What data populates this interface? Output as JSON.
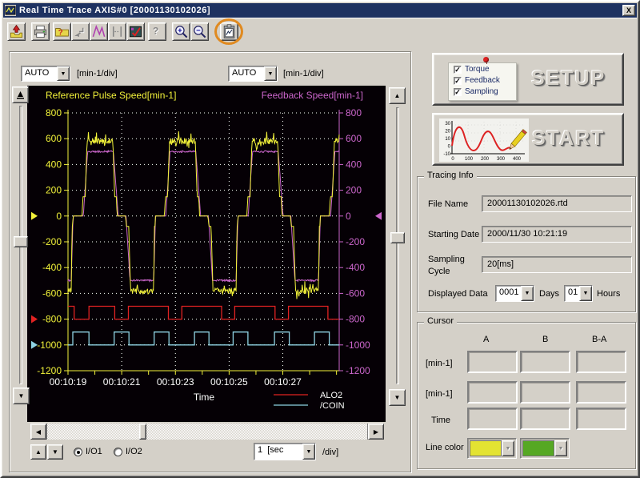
{
  "window": {
    "title": "Real Time Trace  AXIS#0 [20001130102026]",
    "close_label": "X"
  },
  "toolbar": {
    "buttons": [
      {
        "name": "load-trace-data",
        "enabled": true
      },
      {
        "name": "print",
        "enabled": true
      },
      {
        "name": "file-info",
        "enabled": true
      },
      {
        "name": "import-graph",
        "enabled": false
      },
      {
        "name": "waveform-view",
        "enabled": true
      },
      {
        "name": "span-select",
        "enabled": false
      },
      {
        "name": "trace-verify",
        "enabled": true
      },
      {
        "name": "context-help",
        "enabled": false
      },
      {
        "name": "zoom-in",
        "enabled": true
      },
      {
        "name": "zoom-out",
        "enabled": true
      },
      {
        "name": "copy-to-clipboard",
        "enabled": true,
        "highlighted": true
      }
    ]
  },
  "left_panel": {
    "left_axis_combo": {
      "value": "AUTO"
    },
    "left_axis_unit": "[min-1/div]",
    "right_axis_combo": {
      "value": "AUTO"
    },
    "right_axis_unit": "[min-1/div]",
    "io_radio": {
      "options": [
        "I/O1",
        "I/O2"
      ],
      "selected": "I/O1"
    },
    "timebase_combo": {
      "value": "1  [sec"
    },
    "timebase_unit": "/div]"
  },
  "chart_data": {
    "type": "line",
    "background": "#050005",
    "x_axis": {
      "label": "Time",
      "total_seconds": 10.1,
      "tick_step_seconds": 1,
      "labeled_ticks": [
        {
          "t": 0,
          "label": "00:10:19"
        },
        {
          "t": 2,
          "label": "00:10:21"
        },
        {
          "t": 4,
          "label": "00:10:23"
        },
        {
          "t": 6,
          "label": "00:10:25"
        },
        {
          "t": 8,
          "label": "00:10:27"
        }
      ],
      "grid_seconds": [
        2,
        4,
        6,
        8
      ],
      "color": "#f2f23a",
      "label_color": "#ffffff"
    },
    "y_axis_left": {
      "title": "Reference Pulse Speed[min-1]",
      "min": -1200,
      "max": 800,
      "step": 200,
      "color": "#f2f23a"
    },
    "y_axis_right": {
      "title": "Feedback Speed[min-1]",
      "min": -1200,
      "max": 800,
      "step": 200,
      "color": "#cc66cc"
    },
    "series": [
      {
        "name": "Reference Pulse Speed",
        "kind": "cycle",
        "color": "#f2f23a",
        "width": 1,
        "period": 3.07,
        "phase": 2.88,
        "points": [
          [
            0,
            0
          ],
          [
            0.33,
            0
          ],
          [
            0.37,
            150
          ],
          [
            0.45,
            150
          ],
          [
            0.52,
            580
          ],
          [
            1.48,
            580
          ],
          [
            1.55,
            150
          ],
          [
            1.61,
            150
          ],
          [
            1.64,
            0
          ],
          [
            1.95,
            0
          ],
          [
            1.99,
            -80
          ],
          [
            2.07,
            -80
          ],
          [
            2.14,
            -580
          ],
          [
            3.0,
            -580
          ],
          [
            3.03,
            -80
          ],
          [
            3.05,
            -80
          ],
          [
            3.07,
            0
          ]
        ],
        "noise": [
          [
            0.54,
            1.47
          ],
          [
            2.16,
            2.99
          ]
        ],
        "noise_amp": 24,
        "spikes": true
      },
      {
        "name": "Feedback Speed",
        "kind": "cycle",
        "color": "#cc66cc",
        "width": 1,
        "period": 3.07,
        "phase": 2.88,
        "points": [
          [
            0,
            0
          ],
          [
            0.38,
            0
          ],
          [
            0.54,
            500
          ],
          [
            1.5,
            500
          ],
          [
            1.68,
            0
          ],
          [
            1.97,
            0
          ],
          [
            2.12,
            -500
          ],
          [
            3.0,
            -500
          ],
          [
            3.07,
            0
          ]
        ],
        "noise": [
          [
            0.6,
            1.45
          ],
          [
            2.2,
            2.95
          ]
        ],
        "noise_amp": 7,
        "spikes": false
      },
      {
        "name": "ALO2",
        "kind": "square",
        "color": "#e02222",
        "width": 1.3,
        "high": -700,
        "low": -800,
        "start_high": true,
        "transitions": [
          0.23,
          0.78,
          1.74,
          2.25,
          3.74,
          4.24,
          5.72,
          6.21,
          7.71,
          8.21,
          9.68,
          10.1
        ]
      },
      {
        "name": "/COIN",
        "kind": "square",
        "color": "#8ed2e2",
        "width": 1.3,
        "high": -900,
        "low": -1000,
        "start_high": false,
        "transitions": [
          0.18,
          0.78,
          1.72,
          2.27,
          3.21,
          3.76,
          4.71,
          5.25,
          6.15,
          6.7,
          7.69,
          8.24,
          9.18,
          9.73
        ]
      }
    ],
    "legend": [
      {
        "label": "ALO2",
        "color": "#e02222"
      },
      {
        "label": "/COIN",
        "color": "#8ed2e2"
      }
    ],
    "markers": {
      "left": [
        {
          "value": 0,
          "color": "#f2f23a"
        },
        {
          "value": -800,
          "color": "#e02222"
        },
        {
          "value": -1000,
          "color": "#8ed2e2"
        }
      ],
      "right": [
        {
          "value": 0,
          "color": "#cc66cc"
        }
      ]
    }
  },
  "right_panel": {
    "setup_button": {
      "label": "SETUP",
      "checkboxes": [
        "Torque",
        "Feedback",
        "Sampling"
      ]
    },
    "start_button": {
      "label": "START",
      "icon_y_labels": [
        "30",
        "20",
        "10",
        "0",
        "-10"
      ],
      "icon_x_labels": [
        "0",
        "100",
        "200",
        "300",
        "400"
      ]
    },
    "tracing_info": {
      "title": "Tracing Info",
      "file_name_label": "File Name",
      "file_name": "20001130102026.rtd",
      "starting_date_label": "Starting Date",
      "starting_date": "2000/11/30 10:21:19",
      "sampling_cycle_label_1": "Sampling",
      "sampling_cycle_label_2": "Cycle",
      "sampling_cycle": "20[ms]",
      "displayed_data_label": "Displayed Data",
      "days_value": "0001",
      "days_label": "Days",
      "hours_value": "01",
      "hours_label": "Hours"
    },
    "cursor": {
      "title": "Cursor",
      "columns": [
        "A",
        "B",
        "B-A"
      ],
      "row_labels": [
        "[min-1]",
        "[min-1]",
        "Time"
      ],
      "line_color_label": "Line color",
      "colors": [
        "#e3e332",
        "#56a824"
      ]
    }
  }
}
